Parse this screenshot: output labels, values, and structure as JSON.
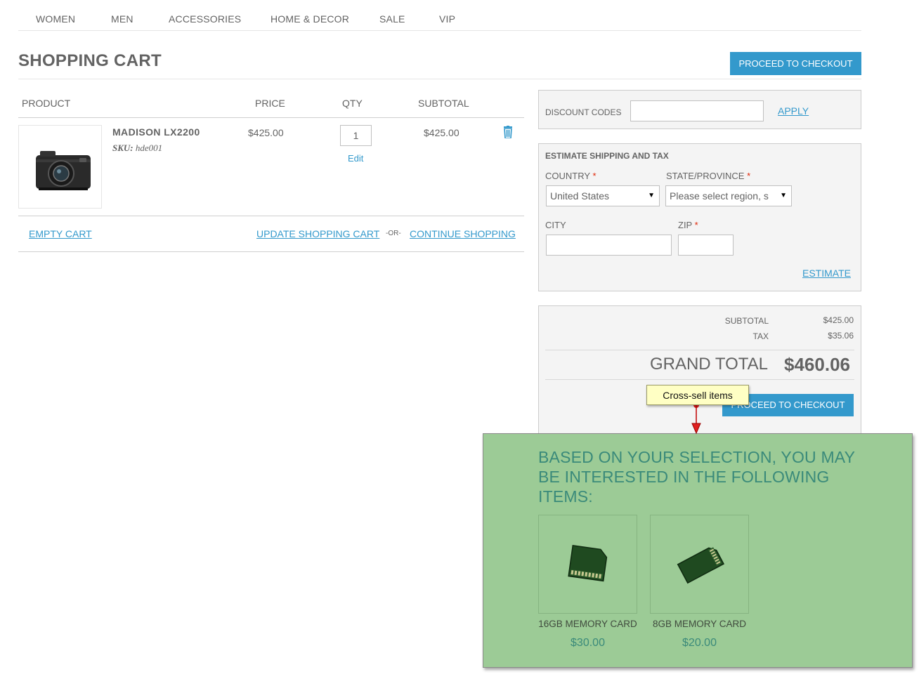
{
  "nav": {
    "items": [
      "WOMEN",
      "MEN",
      "ACCESSORIES",
      "HOME & DECOR",
      "SALE",
      "VIP"
    ]
  },
  "page": {
    "title": "SHOPPING CART",
    "checkout_button": "PROCEED TO CHECKOUT"
  },
  "cart": {
    "headers": {
      "product": "PRODUCT",
      "price": "PRICE",
      "qty": "QTY",
      "subtotal": "SUBTOTAL"
    },
    "items": [
      {
        "name": "MADISON LX2200",
        "sku_label": "SKU:",
        "sku": "hde001",
        "price": "$425.00",
        "qty": "1",
        "edit": "Edit",
        "subtotal": "$425.00",
        "image_icon": "camera-image",
        "remove_icon": "trash-icon"
      }
    ],
    "actions": {
      "empty": "EMPTY CART",
      "update": "UPDATE SHOPPING CART",
      "or": "-OR-",
      "continue": "CONTINUE SHOPPING"
    }
  },
  "discount": {
    "label": "DISCOUNT CODES",
    "value": "",
    "apply": "APPLY"
  },
  "shipping": {
    "title": "ESTIMATE SHIPPING AND TAX",
    "country_label": "COUNTRY",
    "country_value": "United States",
    "state_label": "STATE/PROVINCE",
    "state_value": "Please select region, s",
    "city_label": "CITY",
    "city_value": "",
    "zip_label": "ZIP",
    "zip_value": "",
    "required_mark": "*",
    "estimate": "ESTIMATE"
  },
  "totals": {
    "subtotal_label": "SUBTOTAL",
    "subtotal": "$425.00",
    "tax_label": "TAX",
    "tax": "$35.06",
    "grand_label": "GRAND TOTAL",
    "grand": "$460.06",
    "checkout_button": "PROCEED TO CHECKOUT"
  },
  "tooltip": {
    "text": "Cross-sell items"
  },
  "crosssell": {
    "title": "BASED ON YOUR SELECTION, YOU MAY BE INTERESTED IN THE FOLLOWING ITEMS:",
    "items": [
      {
        "name": "16GB MEMORY CARD",
        "price": "$30.00",
        "icon": "memory-card-image"
      },
      {
        "name": "8GB MEMORY CARD",
        "price": "$20.00",
        "icon": "memory-card-image"
      }
    ]
  },
  "colors": {
    "accent": "#3399cc",
    "overlay_bg": "#9ccb96",
    "overlay_text": "#3a8a7a",
    "required": "#df280a",
    "tooltip_bg": "#ffffc4"
  }
}
